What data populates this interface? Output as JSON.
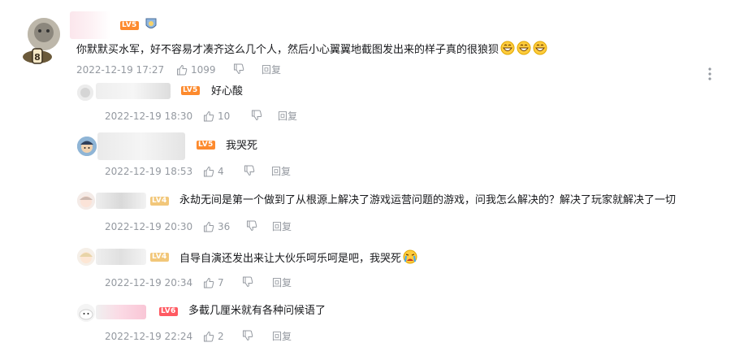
{
  "colors": {
    "text": "#18191c",
    "meta": "#9499a0",
    "lv5": "#fd8a2d",
    "lv4": "#f2c77a",
    "lv6": "#ff5a62"
  },
  "main_comment": {
    "level": "LV5",
    "text": "你默默买水军，好不容易才凑齐这么几个人，然后小心翼翼地截图发出来的样子真的很狼狈",
    "date": "2022-12-19 17:27",
    "likes": "1099",
    "reply_label": "回复",
    "emoji": "grin-emoji"
  },
  "replies": [
    {
      "level": "LV5",
      "text": "好心酸",
      "date": "2022-12-19 18:30",
      "likes": "10",
      "reply_label": "回复"
    },
    {
      "level": "LV5",
      "text": "我哭死",
      "date": "2022-12-19 18:53",
      "likes": "4",
      "reply_label": "回复"
    },
    {
      "level": "LV4",
      "text": "永劫无间是第一个做到了从根源上解决了游戏运营问题的游戏，问我怎么解决的？解决了玩家就解决了一切",
      "date": "2022-12-19 20:30",
      "likes": "36",
      "reply_label": "回复"
    },
    {
      "level": "LV4",
      "text": "自导自演还发出来让大伙乐呵乐呵是吧，我哭死",
      "date": "2022-12-19 20:34",
      "likes": "7",
      "reply_label": "回复"
    },
    {
      "level": "LV6",
      "text": "多截几厘米就有各种问候语了",
      "date": "2022-12-19 22:24",
      "likes": "2",
      "reply_label": "回复"
    }
  ]
}
